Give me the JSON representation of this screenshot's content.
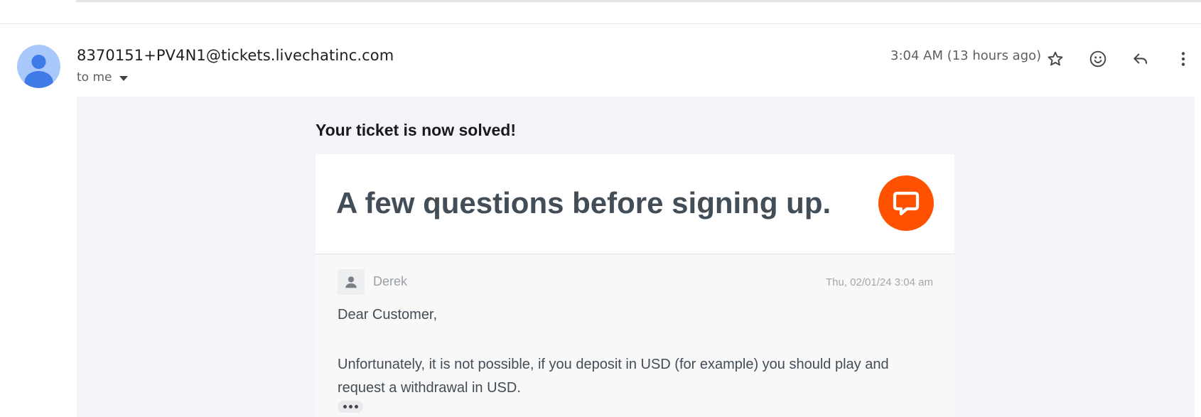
{
  "header": {
    "sender": "8370151+PV4N1@tickets.livechatinc.com",
    "recipient_label": "to me",
    "timestamp": "3:04 AM (13 hours ago)"
  },
  "icons": {
    "avatar": "person-avatar-icon",
    "star": "star-icon",
    "emoji": "emoji-reaction-icon",
    "reply": "reply-icon",
    "more": "more-vert-icon",
    "logo": "livechat-logo-icon",
    "agent": "person-icon"
  },
  "email": {
    "heading": "Your ticket is now solved!",
    "card_title": "A few questions before signing up.",
    "message": {
      "agent_name": "Derek",
      "date": "Thu, 02/01/24 3:04 am",
      "greeting": "Dear Customer,",
      "body": "Unfortunately, it is not possible, if you deposit in USD (for example) you should play and request a withdrawal in USD."
    }
  },
  "colors": {
    "brand": "#ff5100",
    "avatar_bg": "#a8c7fa",
    "avatar_fg": "#1a73e8",
    "mail_bg": "#f3f4f9",
    "text": "#424d57"
  }
}
